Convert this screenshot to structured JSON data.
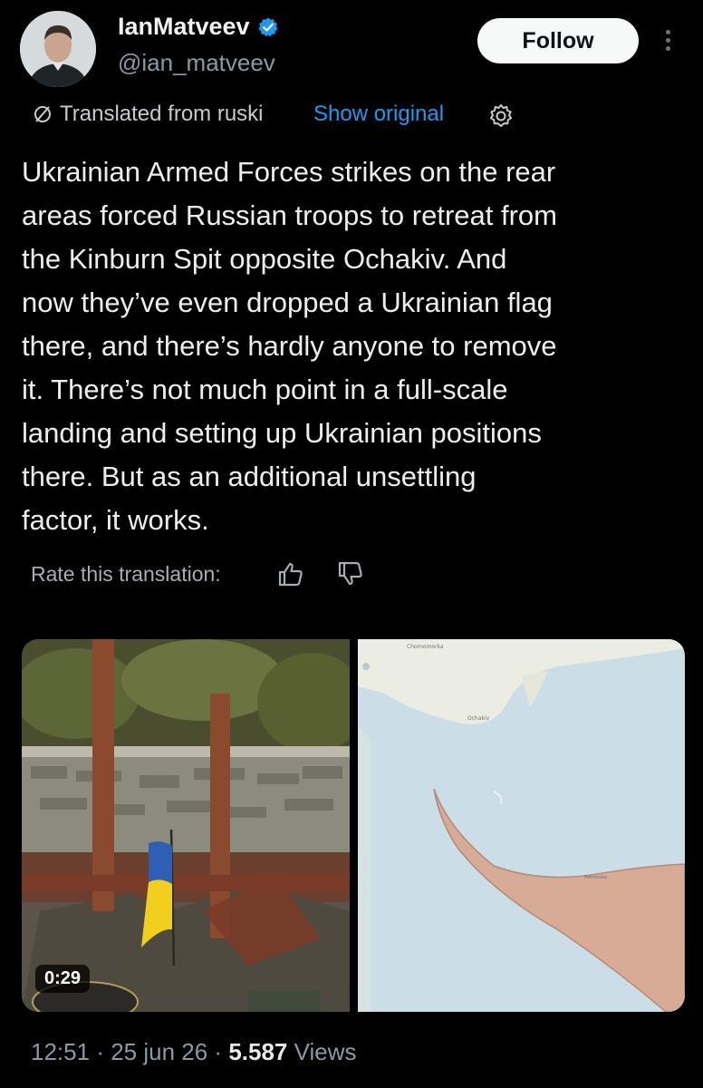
{
  "author": {
    "name": "IanMatveev",
    "handle": "@ian_matveev",
    "verified": true,
    "avatar_icon": "profile-photo"
  },
  "actions": {
    "follow_label": "Follow",
    "more_icon": "vertical-ellipsis-icon"
  },
  "translation": {
    "label": "Translated from ruski",
    "show_original_label": "Show original",
    "settings_icon": "gear-icon",
    "rate_label": "Rate this translation:",
    "thumbs_up_icon": "thumbs-up-icon",
    "thumbs_down_icon": "thumbs-down-icon"
  },
  "post": {
    "text": "Ukrainian Armed Forces strikes on the rear\nareas forced Russian troops to retreat from\nthe Kinburn Spit opposite Ochakiv. And\nnow they’ve even dropped a Ukrainian flag\nthere, and there’s hardly anyone to remove\nit. There’s not much point in a full-scale\nlanding and setting up Ukrainian positions\nthere. But as an additional unsettling\nfactor, it works."
  },
  "media": {
    "video_duration": "0:29",
    "map_labels": {
      "chornomorka": "Chornomorka",
      "ochakiv": "Ochakiv",
      "pokrovske": "Pokrovske"
    }
  },
  "meta": {
    "time": "12:51",
    "date": "25 jun 26",
    "views_count": "5.587",
    "views_label": "Views"
  },
  "colors": {
    "link": "#1d9bf0",
    "sea": "#cbdde6",
    "land": "#ecede2",
    "occupied": "#d7ab95"
  }
}
